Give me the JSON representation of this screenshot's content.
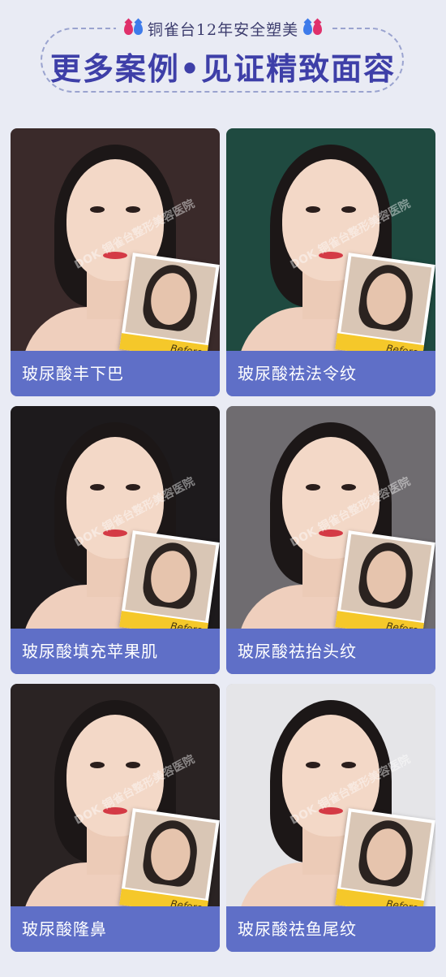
{
  "header": {
    "subtitle": "铜雀台12年安全塑美",
    "title": "更多案例•见证精致面容"
  },
  "cards": [
    {
      "caption": "玻尿酸丰下巴",
      "before_label": "Before",
      "watermark": "DOK 铜雀台整形美容医院",
      "bg": "#3a2a2a"
    },
    {
      "caption": "玻尿酸祛法令纹",
      "before_label": "Before",
      "watermark": "DOK 铜雀台整形美容医院",
      "bg": "#1f4a40"
    },
    {
      "caption": "玻尿酸填充苹果肌",
      "before_label": "Before",
      "watermark": "DOK 铜雀台整形美容医院",
      "bg": "#1d1a1c"
    },
    {
      "caption": "玻尿酸祛抬头纹",
      "before_label": "Before",
      "watermark": "DOK 铜雀台整形美容医院",
      "bg": "#6f6c70"
    },
    {
      "caption": "玻尿酸隆鼻",
      "before_label": "Before",
      "watermark": "DOK 铜雀台整形美容医院",
      "bg": "#2a2323"
    },
    {
      "caption": "玻尿酸祛鱼尾纹",
      "before_label": "Before",
      "watermark": "DOK 铜雀台整形美容医院",
      "bg": "#e5e5e8"
    }
  ]
}
